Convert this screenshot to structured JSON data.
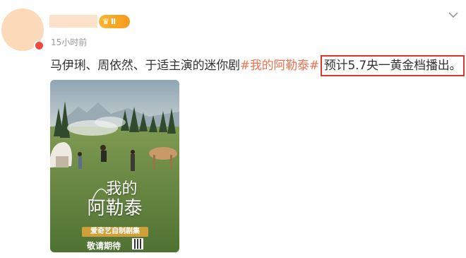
{
  "post": {
    "timestamp": "15小时前",
    "text_prefix": "马伊琍、周依然、于适主演的迷你剧",
    "hashtag": "#我的阿勒泰#",
    "text_highlight": "预计5.7央一黄金档播出。",
    "vip_level": "Ⅱ"
  },
  "poster": {
    "title_line1": "我的",
    "title_line2": "阿勒泰",
    "platform_label": "爱奇艺自制剧集",
    "coming_soon": "敬请期待"
  },
  "colors": {
    "hashtag": "#eb7350",
    "highlight_border": "#e0352b",
    "vip": "#f7b633"
  }
}
